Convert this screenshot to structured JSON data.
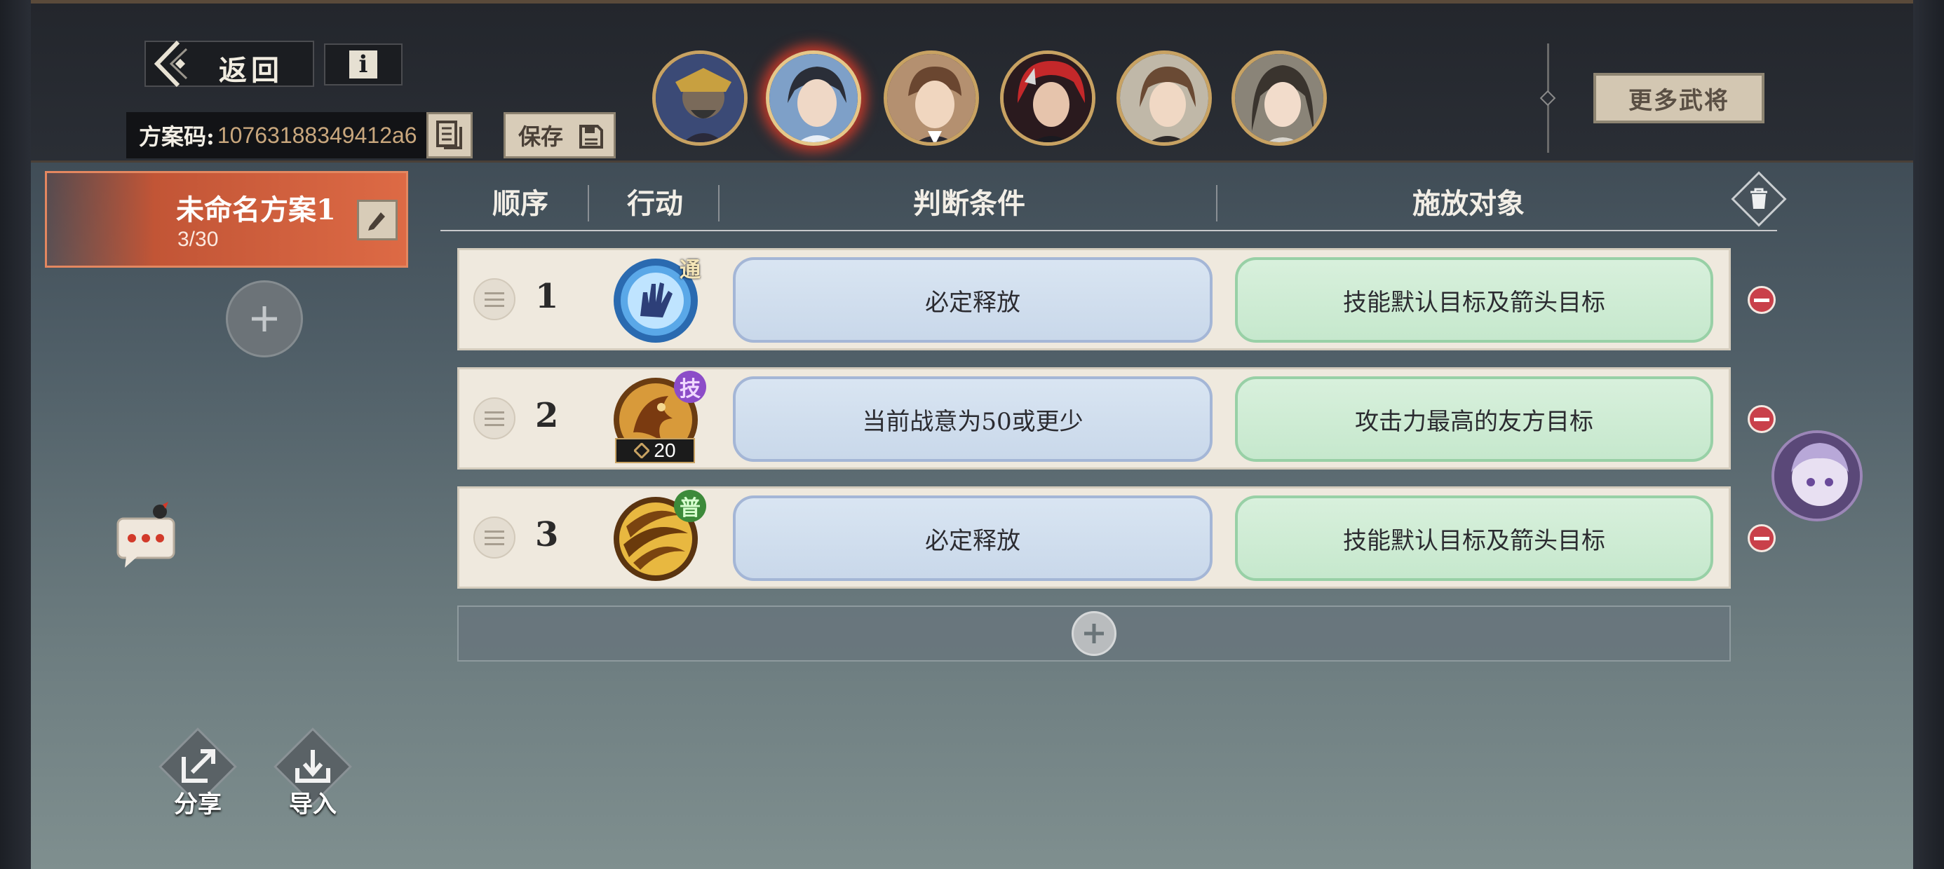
{
  "header": {
    "back_label": "返回",
    "info_label": "i",
    "code_label": "方案码:",
    "code_value": "10763188349412a6",
    "save_label": "保存",
    "more_generals_label": "更多武将"
  },
  "portraits": [
    {
      "name": "general-1",
      "selected": false
    },
    {
      "name": "general-2",
      "selected": true
    },
    {
      "name": "general-3",
      "selected": false
    },
    {
      "name": "general-4",
      "selected": false
    },
    {
      "name": "general-5",
      "selected": false
    },
    {
      "name": "general-6",
      "selected": false
    }
  ],
  "plan": {
    "title": "未命名方案1",
    "count": "3/30"
  },
  "columns": {
    "order": "顺序",
    "action": "行动",
    "condition": "判断条件",
    "target": "施放对象"
  },
  "rows": [
    {
      "num": "1",
      "badge": "通",
      "skill_icon": "hand-skill-icon",
      "condition": "必定释放",
      "target": "技能默认目标及箭头目标"
    },
    {
      "num": "2",
      "badge": "技",
      "skill_icon": "dragon-skill-icon",
      "cost": "20",
      "condition": "当前战意为50或更少",
      "target": "攻击力最高的友方目标"
    },
    {
      "num": "3",
      "badge": "普",
      "skill_icon": "whirl-skill-icon",
      "condition": "必定释放",
      "target": "技能默认目标及箭头目标"
    }
  ],
  "bottom": {
    "share_label": "分享",
    "import_label": "导入"
  },
  "colors": {
    "accent_plan": "#dd6a45",
    "condition_bg": "#c9d8ea",
    "target_bg": "#c6e8cd",
    "remove": "#c9404a",
    "gold": "#c8a262"
  }
}
